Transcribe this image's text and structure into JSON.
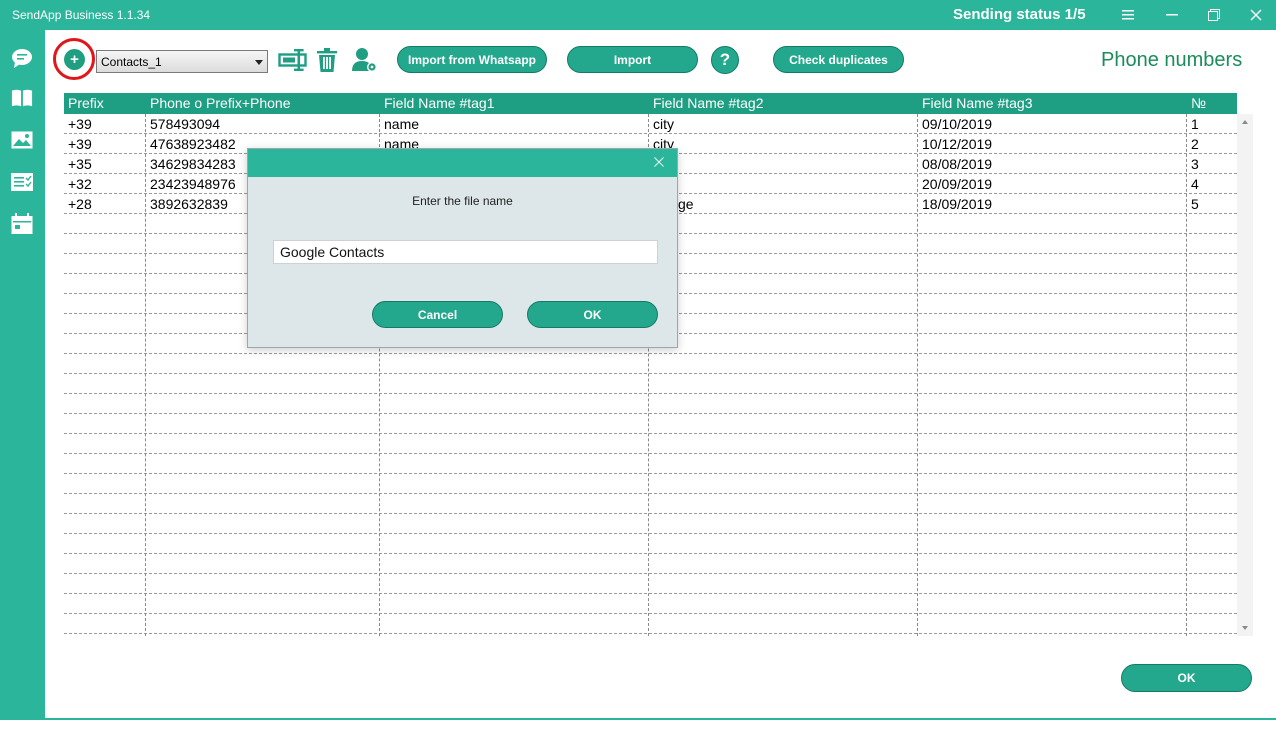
{
  "window": {
    "title": "SendApp Business 1.1.34",
    "sending_status": "Sending status 1/5"
  },
  "toolbar": {
    "contact_list_selected": "Contacts_1",
    "import_whatsapp_label": "Import from Whatsapp",
    "import_label": "Import",
    "help_label": "?",
    "check_duplicates_label": "Check duplicates",
    "add_label": "+"
  },
  "page": {
    "heading": "Phone numbers"
  },
  "table": {
    "headers": [
      "Prefix",
      "Phone o Prefix+Phone",
      "Field Name #tag1",
      "Field Name #tag2",
      "Field Name #tag3",
      "№"
    ],
    "rows": [
      [
        "+39",
        "578493094",
        "name",
        "city",
        "09/10/2019",
        "1"
      ],
      [
        "+39",
        "47638923482",
        "name",
        "city",
        "10/12/2019",
        "2"
      ],
      [
        "+35",
        "34629834283",
        "",
        "",
        "08/08/2019",
        "3"
      ],
      [
        "+32",
        "23423948976",
        "",
        "",
        "20/09/2019",
        "4"
      ],
      [
        "+28",
        "3892632839",
        "",
        "ge",
        "18/09/2019",
        "5"
      ]
    ]
  },
  "dialog": {
    "prompt": "Enter the file name",
    "input_value": "Google Contacts",
    "cancel_label": "Cancel",
    "ok_label": "OK"
  },
  "footer": {
    "ok_label": "OK"
  },
  "colors": {
    "brand": "#2bb59a",
    "button": "#23a88d",
    "table_header": "#1e9e82",
    "heading_text": "#1c8c5a",
    "highlight_ring": "#e0161b"
  }
}
